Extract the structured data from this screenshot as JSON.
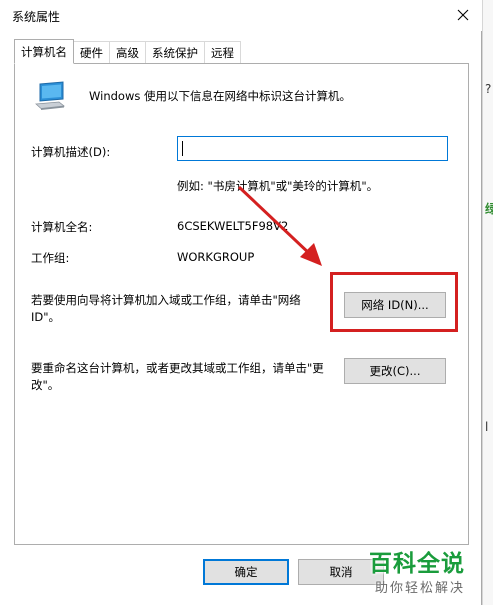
{
  "window": {
    "title": "系统属性"
  },
  "tabs": [
    {
      "label": "计算机名",
      "active": true
    },
    {
      "label": "硬件",
      "active": false
    },
    {
      "label": "高级",
      "active": false
    },
    {
      "label": "系统保护",
      "active": false
    },
    {
      "label": "远程",
      "active": false
    }
  ],
  "computer_name": {
    "intro": "Windows 使用以下信息在网络中标识这台计算机。",
    "description_label": "计算机描述(D):",
    "description_value": "",
    "example": "例如: \"书房计算机\"或\"美玲的计算机\"。",
    "full_name_label": "计算机全名:",
    "full_name_value": "6CSEKWELT5F98V2",
    "workgroup_label": "工作组:",
    "workgroup_value": "WORKGROUP",
    "network_id_text": "若要使用向导将计算机加入域或工作组，请单击\"网络 ID\"。",
    "network_id_button": "网络 ID(N)...",
    "rename_text": "要重命名这台计算机，或者更改其域或工作组，请单击\"更改\"。",
    "change_button": "更改(C)..."
  },
  "footer": {
    "ok_button": "确定",
    "cancel_button": "取消"
  },
  "watermark": {
    "main": "百科全说",
    "sub": "助你轻松解决"
  },
  "background_window": {
    "glyphs": [
      "?",
      "绿",
      "l"
    ]
  },
  "colors": {
    "highlight": "#d42020",
    "focus_blue": "#0078d7",
    "watermark_green": "#1a9c3c"
  }
}
